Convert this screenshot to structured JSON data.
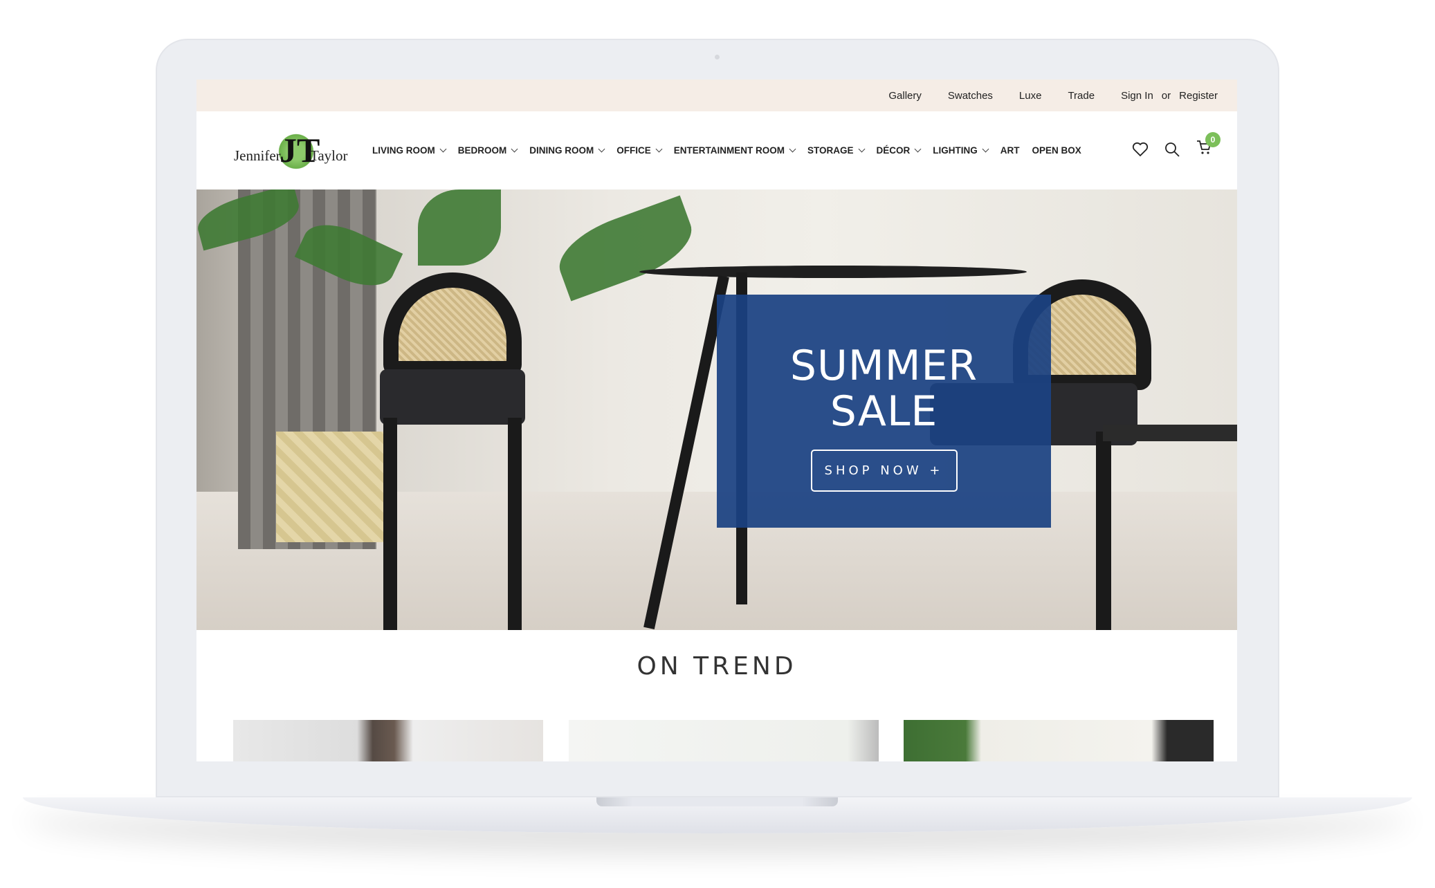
{
  "topbar": {
    "links": [
      "Gallery",
      "Swatches",
      "Luxe",
      "Trade"
    ],
    "sign_in": "Sign In",
    "or": "or",
    "register": "Register"
  },
  "logo": {
    "left": "Jennifer",
    "mark": "JT",
    "right": "Taylor"
  },
  "nav": {
    "items": [
      {
        "label": "LIVING ROOM",
        "dropdown": true
      },
      {
        "label": "BEDROOM",
        "dropdown": true
      },
      {
        "label": "DINING ROOM",
        "dropdown": true
      },
      {
        "label": "OFFICE",
        "dropdown": true
      },
      {
        "label": "ENTERTAINMENT ROOM",
        "dropdown": true
      },
      {
        "label": "STORAGE",
        "dropdown": true
      },
      {
        "label": "DÉCOR",
        "dropdown": true
      },
      {
        "label": "LIGHTING",
        "dropdown": true
      },
      {
        "label": "ART",
        "dropdown": false
      },
      {
        "label": "OPEN BOX",
        "dropdown": false
      }
    ]
  },
  "icons": {
    "wishlist": "heart-icon",
    "search": "search-icon",
    "cart": "cart-icon",
    "cart_count": "0"
  },
  "hero": {
    "title_line1": "SUMMER",
    "title_line2": "SALE",
    "button": "SHOP NOW +",
    "panel_color": "#1b4282"
  },
  "section": {
    "title": "ON TREND"
  },
  "colors": {
    "topbar": "#f5ede6",
    "badge": "#7cbf5a"
  }
}
